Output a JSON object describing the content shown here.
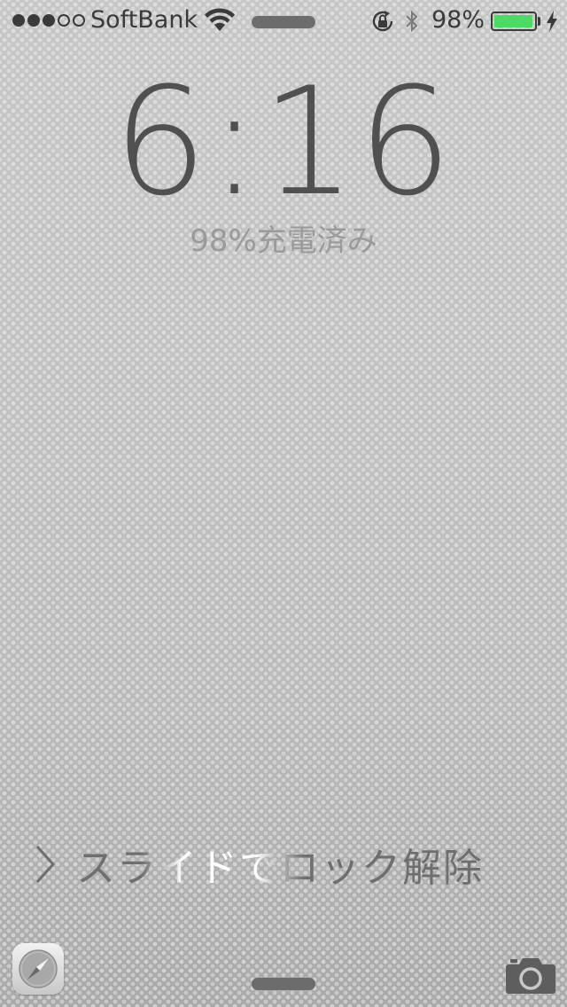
{
  "status_bar": {
    "signal_bars_total": 5,
    "signal_bars_filled": 3,
    "carrier": "SoftBank",
    "battery_percent_label": "98%",
    "battery_level": 0.98,
    "battery_color": "#4cd964",
    "icons": [
      "wifi-icon",
      "lock-rotation-icon",
      "bluetooth-icon",
      "battery-icon",
      "charging-bolt-icon"
    ]
  },
  "lock_screen": {
    "time": "6:16",
    "charge_status": "98%充電済み",
    "slide_to_unlock": "スライドでロック解除"
  },
  "bottom_bar": {
    "left_icon": "safari-icon",
    "right_icon": "camera-icon"
  }
}
